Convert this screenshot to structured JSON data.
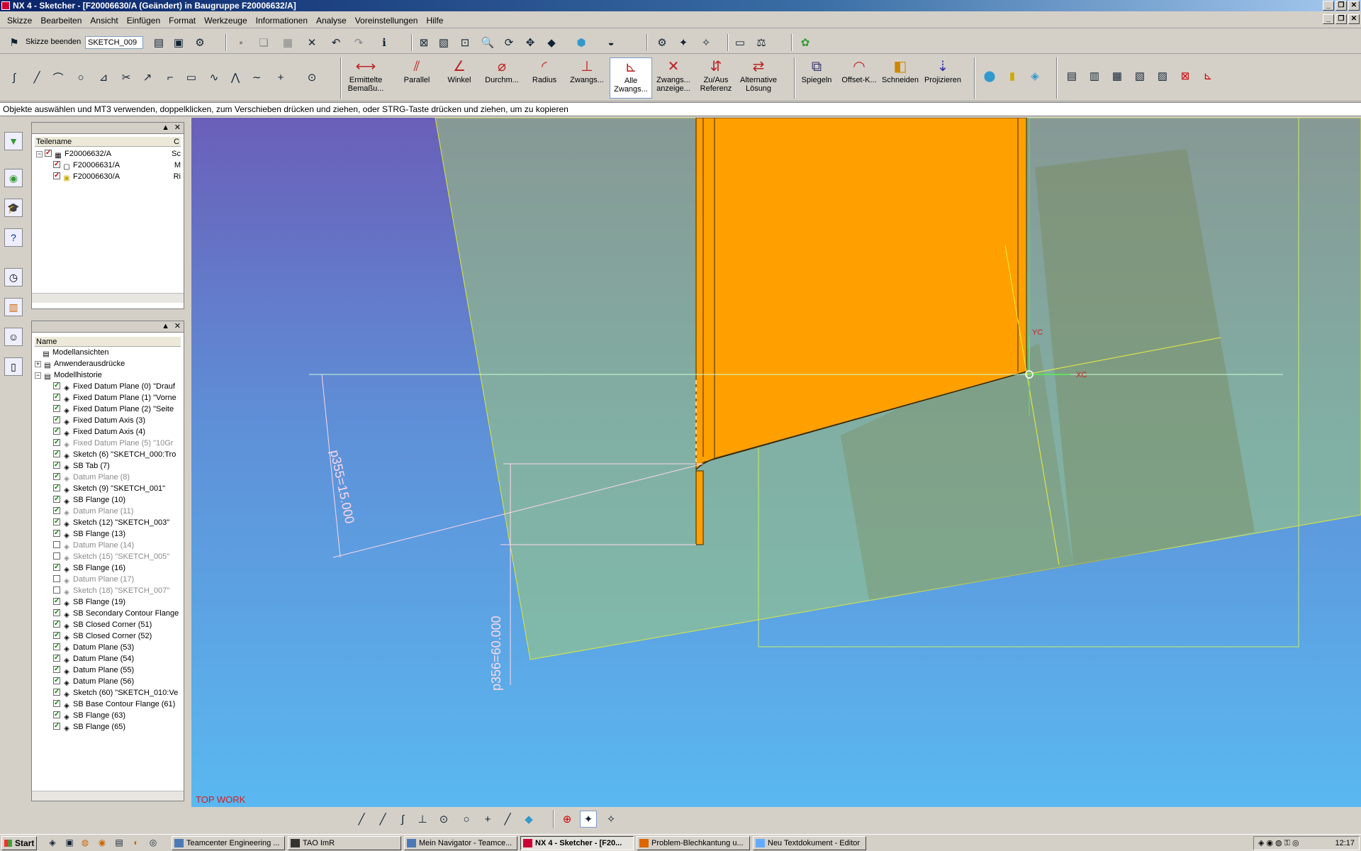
{
  "window": {
    "title": "NX 4 - Sketcher - [F20006630/A (Geändert)  in Baugruppe F20006632/A]"
  },
  "menu": [
    "Skizze",
    "Bearbeiten",
    "Ansicht",
    "Einfügen",
    "Format",
    "Werkzeuge",
    "Informationen",
    "Analyse",
    "Voreinstellungen",
    "Hilfe"
  ],
  "toolbar1": {
    "finish_sketch_label": "Skizze beenden",
    "sketch_name": "SKETCH_009"
  },
  "toolbar2": {
    "constraint_buttons": [
      {
        "label": "Ermittelte Bemaßu...",
        "icon": "inferred-dimension-icon"
      },
      {
        "label": "Parallel",
        "icon": "parallel-icon"
      },
      {
        "label": "Winkel",
        "icon": "angle-icon"
      },
      {
        "label": "Durchm...",
        "icon": "diameter-icon"
      },
      {
        "label": "Radius",
        "icon": "radius-icon"
      },
      {
        "label": "Zwangs...",
        "icon": "constraints-icon"
      },
      {
        "label": "Alle Zwangs...",
        "icon": "show-all-constraints-icon"
      },
      {
        "label": "Zwangs... anzeige...",
        "icon": "show-constraints-icon"
      },
      {
        "label": "Zu/Aus Referenz",
        "icon": "reference-toggle-icon"
      },
      {
        "label": "Alternative Lösung",
        "icon": "alternate-solution-icon"
      }
    ],
    "operation_buttons": [
      {
        "label": "Spiegeln",
        "icon": "mirror-icon"
      },
      {
        "label": "Offset-K...",
        "icon": "offset-curve-icon"
      },
      {
        "label": "Schneiden",
        "icon": "trim-icon"
      },
      {
        "label": "Projizieren",
        "icon": "project-icon"
      }
    ]
  },
  "status_message": "Objekte auswählen und MT3 verwenden, doppelklicken, zum Verschieben drücken und ziehen, oder STRG-Taste drücken und ziehen, um zu kopieren",
  "assembly_navigator": {
    "column_header": "Teilename",
    "column2_header": "C",
    "rows": [
      {
        "name": "F20006632/A",
        "col2": "Sc"
      },
      {
        "name": "F20006631/A",
        "col2": "M"
      },
      {
        "name": "F20006630/A",
        "col2": "Ri"
      }
    ]
  },
  "part_navigator": {
    "column_header": "Name",
    "groups": [
      "Modellansichten",
      "Anwenderausdrücke",
      "Modellhistorie"
    ],
    "features": [
      {
        "name": "Fixed Datum Plane (0) \"Drauf",
        "checked": true,
        "dim": false
      },
      {
        "name": "Fixed Datum Plane (1) \"Vorne",
        "checked": true,
        "dim": false
      },
      {
        "name": "Fixed Datum Plane (2) \"Seite",
        "checked": true,
        "dim": false
      },
      {
        "name": "Fixed Datum Axis (3)",
        "checked": true,
        "dim": false
      },
      {
        "name": "Fixed Datum Axis (4)",
        "checked": true,
        "dim": false
      },
      {
        "name": "Fixed Datum Plane (5) \"10Gr",
        "checked": true,
        "dim": true
      },
      {
        "name": "Sketch (6) \"SKETCH_000:Tro",
        "checked": true,
        "dim": false
      },
      {
        "name": "SB Tab (7)",
        "checked": true,
        "dim": false
      },
      {
        "name": "Datum Plane (8)",
        "checked": true,
        "dim": true
      },
      {
        "name": "Sketch (9) \"SKETCH_001\"",
        "checked": true,
        "dim": false
      },
      {
        "name": "SB Flange (10)",
        "checked": true,
        "dim": false
      },
      {
        "name": "Datum Plane (11)",
        "checked": true,
        "dim": true
      },
      {
        "name": "Sketch (12) \"SKETCH_003\"",
        "checked": true,
        "dim": false
      },
      {
        "name": "SB Flange (13)",
        "checked": true,
        "dim": false
      },
      {
        "name": "Datum Plane (14)",
        "checked": false,
        "dim": true
      },
      {
        "name": "Sketch (15) \"SKETCH_005\"",
        "checked": false,
        "dim": true
      },
      {
        "name": "SB Flange (16)",
        "checked": true,
        "dim": false
      },
      {
        "name": "Datum Plane (17)",
        "checked": false,
        "dim": true
      },
      {
        "name": "Sketch (18) \"SKETCH_007\"",
        "checked": false,
        "dim": true
      },
      {
        "name": "SB Flange (19)",
        "checked": true,
        "dim": false
      },
      {
        "name": "SB Secondary Contour Flange",
        "checked": true,
        "dim": false
      },
      {
        "name": "SB Closed Corner (51)",
        "checked": true,
        "dim": false
      },
      {
        "name": "SB Closed Corner (52)",
        "checked": true,
        "dim": false
      },
      {
        "name": "Datum Plane (53)",
        "checked": true,
        "dim": false
      },
      {
        "name": "Datum Plane (54)",
        "checked": true,
        "dim": false
      },
      {
        "name": "Datum Plane (55)",
        "checked": true,
        "dim": false
      },
      {
        "name": "Datum Plane (56)",
        "checked": true,
        "dim": false
      },
      {
        "name": "Sketch (60) \"SKETCH_010:Ve",
        "checked": true,
        "dim": false
      },
      {
        "name": "SB Base Contour Flange (61)",
        "checked": true,
        "dim": false
      },
      {
        "name": "SB Flange (63)",
        "checked": true,
        "dim": false
      },
      {
        "name": "SB Flange (65)",
        "checked": true,
        "dim": false
      }
    ]
  },
  "viewport": {
    "view_label": "TOP WORK",
    "dimension_1": "p355=15.000",
    "dimension_2": "p356=60.000",
    "axis_x": "XC",
    "axis_y": "YC",
    "colors": {
      "background_top": "#6a5fb8",
      "background_bottom": "#5ab8f0",
      "part": "#ffa000",
      "datum": "#9ec878"
    }
  },
  "taskbar": {
    "start_label": "Start",
    "tasks": [
      {
        "label": "Teamcenter Engineering ...",
        "active": false
      },
      {
        "label": "TAO ImR",
        "active": false
      },
      {
        "label": "Mein Navigator - Teamce...",
        "active": false
      },
      {
        "label": "NX 4 - Sketcher - [F20...",
        "active": true
      },
      {
        "label": "Problem-Blechkantung u...",
        "active": false
      },
      {
        "label": "Neu Textdokument - Editor",
        "active": false
      }
    ],
    "clock": "12:17"
  }
}
